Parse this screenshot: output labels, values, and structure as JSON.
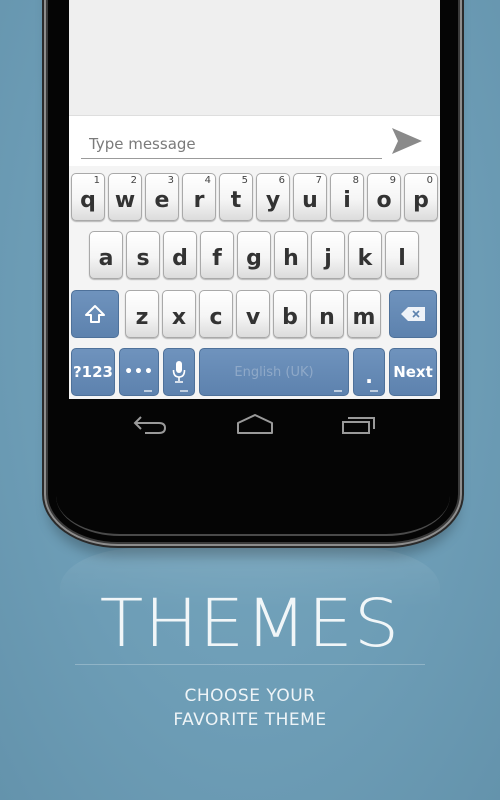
{
  "message": {
    "placeholder": "Type message",
    "send_icon": "send-icon"
  },
  "keyboard": {
    "row1": [
      {
        "key": "q",
        "hint": "1"
      },
      {
        "key": "w",
        "hint": "2"
      },
      {
        "key": "e",
        "hint": "3"
      },
      {
        "key": "r",
        "hint": "4"
      },
      {
        "key": "t",
        "hint": "5"
      },
      {
        "key": "y",
        "hint": "6"
      },
      {
        "key": "u",
        "hint": "7"
      },
      {
        "key": "i",
        "hint": "8"
      },
      {
        "key": "o",
        "hint": "9"
      },
      {
        "key": "p",
        "hint": "0"
      }
    ],
    "row2": [
      "a",
      "s",
      "d",
      "f",
      "g",
      "h",
      "j",
      "k",
      "l"
    ],
    "row3": [
      "z",
      "x",
      "c",
      "v",
      "b",
      "n",
      "m"
    ],
    "shift_icon": "shift-arrow-icon",
    "backspace_icon": "backspace-icon",
    "symbols_label": "?123",
    "more_label": "•••",
    "mic_icon": "microphone-icon",
    "space_label": "English (UK)",
    "period_label": ".",
    "next_label": "Next"
  },
  "navbar": {
    "back_icon": "back-icon",
    "home_icon": "home-icon",
    "recents_icon": "recents-icon"
  },
  "promo": {
    "title": "THEMES",
    "subtitle_line1": "CHOOSE YOUR",
    "subtitle_line2": "FAVORITE THEME"
  },
  "colors": {
    "background": "#6d9db6",
    "function_key": "#5d82ae",
    "key_face": "#f5f5f5",
    "phone_body": "#050505"
  }
}
